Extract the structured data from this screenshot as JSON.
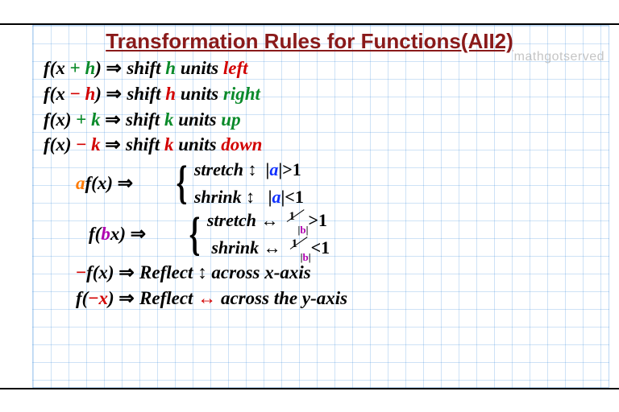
{
  "title": "Transformation Rules for Functions(AII2)",
  "watermark": "mathgotserved",
  "sym": {
    "implies": "⇒",
    "updown": "↕",
    "leftright": "↔",
    "bar": "|"
  },
  "rules": {
    "r1": {
      "lhs_pre": "f(x",
      "op": "+",
      "var": "h",
      "lhs_post": ")",
      "word1": "shift",
      "unit": "h",
      "word2": "units",
      "dir": "left"
    },
    "r2": {
      "lhs_pre": "f(x",
      "op": "−",
      "var": "h",
      "lhs_post": ")",
      "word1": "shift",
      "unit": "h",
      "word2": "units",
      "dir": "right"
    },
    "r3": {
      "lhs": "f(x)",
      "op": "+",
      "var": "k",
      "word1": "shift",
      "unit": "k",
      "word2": "units",
      "dir": "up"
    },
    "r4": {
      "lhs": "f(x)",
      "op": "−",
      "var": "k",
      "word1": "shift",
      "unit": "k",
      "word2": "units",
      "dir": "down"
    },
    "af": {
      "coef": "a",
      "fn": "f(x)",
      "case1": {
        "label": "stretch",
        "cond_var": "a",
        "cmp": ">1"
      },
      "case2": {
        "label": "shrink",
        "cond_var": "a",
        "cmp": "<1"
      }
    },
    "bf": {
      "fn_pre": "f(",
      "coef": "b",
      "fn_post": "x)",
      "case1": {
        "label": "stretch",
        "num": "1",
        "den": "b",
        "cmp": ">1"
      },
      "case2": {
        "label": "shrink",
        "num": "1",
        "den": "b",
        "cmp": "<1"
      }
    },
    "negf": {
      "pre": "−",
      "fn": "f(x)",
      "word1": "Reflect",
      "word2": "across x-axis"
    },
    "fneg": {
      "fn_pre": "f(",
      "neg": "−",
      "var": "x",
      "fn_post": ")",
      "word1": "Reflect",
      "word2": "across the y-axis"
    }
  }
}
